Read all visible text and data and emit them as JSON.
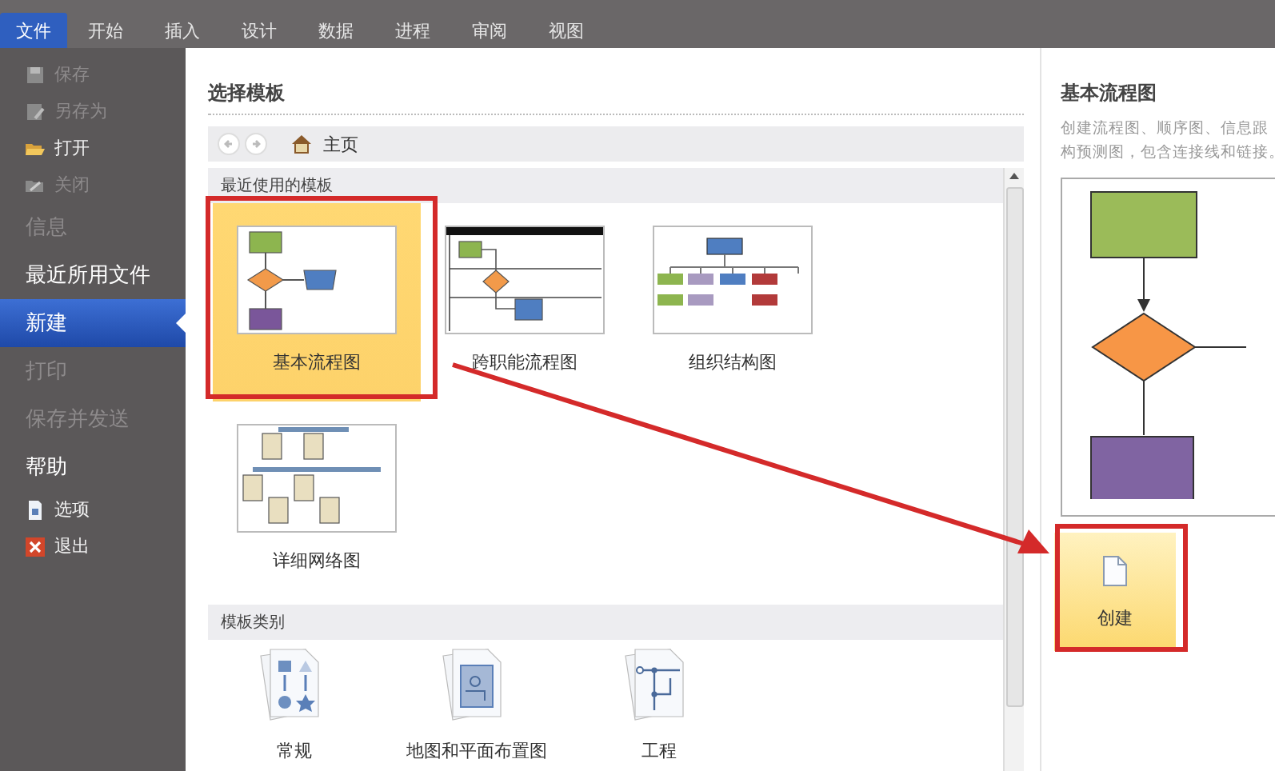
{
  "tabs": [
    {
      "label": "文件",
      "selected": true
    },
    {
      "label": "开始",
      "selected": false
    },
    {
      "label": "插入",
      "selected": false
    },
    {
      "label": "设计",
      "selected": false
    },
    {
      "label": "数据",
      "selected": false
    },
    {
      "label": "进程",
      "selected": false
    },
    {
      "label": "审阅",
      "selected": false
    },
    {
      "label": "视图",
      "selected": false
    }
  ],
  "sidebar": {
    "items": [
      {
        "kind": "command",
        "label": "保存",
        "disabled": true,
        "selected": false
      },
      {
        "kind": "command",
        "label": "另存为",
        "disabled": true,
        "selected": false
      },
      {
        "kind": "command",
        "label": "打开",
        "disabled": false,
        "selected": false
      },
      {
        "kind": "command",
        "label": "关闭",
        "disabled": true,
        "selected": false
      },
      {
        "kind": "section",
        "label": "信息",
        "disabled": true,
        "selected": false
      },
      {
        "kind": "section",
        "label": "最近所用文件",
        "disabled": false,
        "selected": false
      },
      {
        "kind": "section",
        "label": "新建",
        "disabled": false,
        "selected": true
      },
      {
        "kind": "section",
        "label": "打印",
        "disabled": true,
        "selected": false
      },
      {
        "kind": "section",
        "label": "保存并发送",
        "disabled": true,
        "selected": false
      },
      {
        "kind": "section",
        "label": "帮助",
        "disabled": false,
        "selected": false
      },
      {
        "kind": "command",
        "label": "选项",
        "disabled": false,
        "selected": false
      },
      {
        "kind": "command",
        "label": "退出",
        "disabled": false,
        "selected": false
      }
    ]
  },
  "templates": {
    "heading": "选择模板",
    "nav": {
      "location": "主页"
    },
    "recent": {
      "title": "最近使用的模板",
      "items": [
        {
          "label": "基本流程图",
          "selected": true
        },
        {
          "label": "跨职能流程图",
          "selected": false
        },
        {
          "label": "组织结构图",
          "selected": false
        },
        {
          "label": "详细网络图",
          "selected": false
        }
      ]
    },
    "categories": {
      "title": "模板类别",
      "items": [
        {
          "label": "常规"
        },
        {
          "label": "地图和平面布置图"
        },
        {
          "label": "工程"
        }
      ]
    }
  },
  "preview": {
    "title": "基本流程图",
    "description": [
      "创建流程图、顺序图、信息跟",
      "构预测图，包含连接线和链接。"
    ],
    "create_button": "创建"
  }
}
